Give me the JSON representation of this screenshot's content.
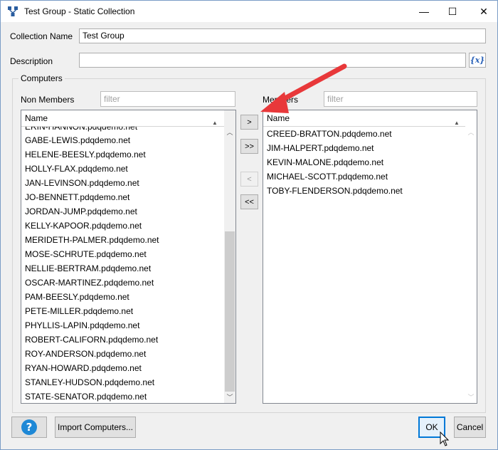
{
  "window": {
    "title": "Test Group - Static Collection",
    "minimize": "—",
    "maximize": "☐",
    "close": "✕"
  },
  "form": {
    "collection_name_label": "Collection Name",
    "collection_name_value": "Test Group",
    "description_label": "Description",
    "description_value": "",
    "variable_button": "{x}"
  },
  "computers": {
    "group_label": "Computers",
    "non_members_label": "Non Members",
    "non_members_filter_placeholder": "filter",
    "members_label": "Members",
    "members_filter_placeholder": "filter",
    "column_header": "Name",
    "non_members": [
      "ERIN-HANNON.pdqdemo.net",
      "GABE-LEWIS.pdqdemo.net",
      "HELENE-BEESLY.pdqdemo.net",
      "HOLLY-FLAX.pdqdemo.net",
      "JAN-LEVINSON.pdqdemo.net",
      "JO-BENNETT.pdqdemo.net",
      "JORDAN-JUMP.pdqdemo.net",
      "KELLY-KAPOOR.pdqdemo.net",
      "MERIDETH-PALMER.pdqdemo.net",
      "MOSE-SCHRUTE.pdqdemo.net",
      "NELLIE-BERTRAM.pdqdemo.net",
      "OSCAR-MARTINEZ.pdqdemo.net",
      "PAM-BEESLY.pdqdemo.net",
      "PETE-MILLER.pdqdemo.net",
      "PHYLLIS-LAPIN.pdqdemo.net",
      "ROBERT-CALIFORN.pdqdemo.net",
      "ROY-ANDERSON.pdqdemo.net",
      "RYAN-HOWARD.pdqdemo.net",
      "STANLEY-HUDSON.pdqdemo.net",
      "STATE-SENATOR.pdqdemo.net"
    ],
    "members": [
      "CREED-BRATTON.pdqdemo.net",
      "JIM-HALPERT.pdqdemo.net",
      "KEVIN-MALONE.pdqdemo.net",
      "MICHAEL-SCOTT.pdqdemo.net",
      "TOBY-FLENDERSON.pdqdemo.net"
    ],
    "move_buttons": {
      "add_selected": ">",
      "add_all": ">>",
      "remove_selected": "<",
      "remove_all": "<<"
    }
  },
  "footer": {
    "help_button": "?",
    "import_button": "Import Computers...",
    "ok_button": "OK",
    "cancel_button": "Cancel"
  },
  "colors": {
    "accent": "#0078d7",
    "annotation_arrow": "#e8383a",
    "help_icon": "#1e88d6"
  },
  "icons": {
    "app_icon": "pdq-network-icon",
    "annotation": "red-arrow-icon",
    "cursor": "mouse-pointer-icon"
  }
}
